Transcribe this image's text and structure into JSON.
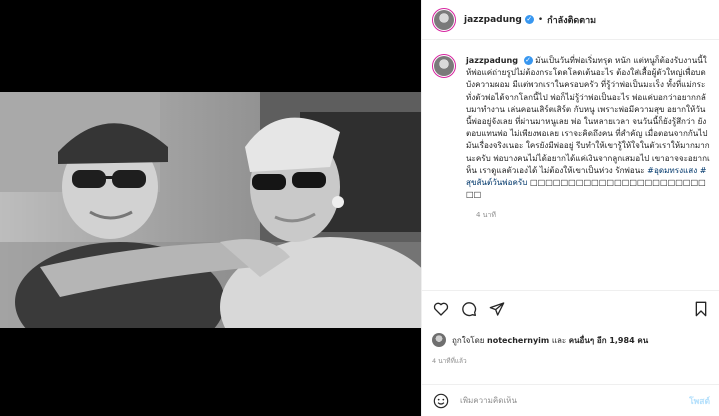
{
  "header": {
    "username": "jazzpadung",
    "separator": "•",
    "follow_status": "กำลังติดตาม"
  },
  "caption": {
    "username": "jazzpadung",
    "text": "มันเป็นวันที่พ่อเริ่มทรุด หนัก แต่หนูก็ต้องรับงานนี้ให้พ่อแค่ถ่ายรูปไม่ต้องกระโดดโลดเต้นอะไร ต้องใส่เสื้อผู้ตัวใหญ่เพื่อบดบังความผอม มีแต่พวกเราในครอบครัว ที่รู้ว่าพ่อเป็นมะเร็ง ทั้งที่แม่กระทั่งตัวพ่อได้จากโลกนี้ไป พ่อก็ไม่รู้ว่าพ่อเป็นอะไร พ่อแค่บอกว่าอยากกลับมาทำงาน เล่นคอนเสิร์ตเสิร์ต กับหนู เพราะพ่อมีความสุข อยากให้วันนี้พ่ออยู่จังเลย ที่ผ่านมาหนูเลย พ่อ ในหลายเวลา จนวันนี้ก็ยังรู้สึกว่า ยังตอบแทนพ่อ ไม่เพียงพอเลย เราจะคิดถึงคน ที่สำคัญ เมื่อตอนจากกันไป มันเรื่องจริงเนอะ ใครยังมีพ่ออยู่ รีบทำให้เขารู้ให้ใจในตัวเราให้มากมากนะครับ พ่อบางคนไม่ได้อยากได้แค่เงินจากลูกเสมอไป เขาอาจจะอยากเห็น เราดูแลตัวเองได้ ไม่ต้องให้เขาเป็นห่วง รักพ่อนะ ",
    "hashtag1": "#อุดมทรงแสง",
    "hashtag2": "#สุขสันต์วันพ่อครับ",
    "trailing": " □□□□□□□□□□□□□□□□□□□□□□□□□",
    "time_ago": "4 นาที"
  },
  "likes": {
    "prefix": "ถูกใจโดย",
    "liker": "notechernyim",
    "joiner": "และ",
    "others": "คนอื่นๆ อีก 1,984 คน"
  },
  "post_time": "4 นาทีที่แล้ว",
  "comment": {
    "placeholder": "เพิ่มความคิดเห็น",
    "post_label": "โพสต์"
  },
  "colors": {
    "verified": "#3897f0",
    "hashtag": "#00376b",
    "post_button_disabled": "#b2dffc",
    "secondary_text": "#8e8e8e"
  },
  "icons": {
    "verified": "verified-badge-icon",
    "like": "heart-icon",
    "comment": "comment-icon",
    "share": "paper-plane-icon",
    "save": "bookmark-icon",
    "emoji": "smiley-icon",
    "tag": "user-tag-icon"
  }
}
